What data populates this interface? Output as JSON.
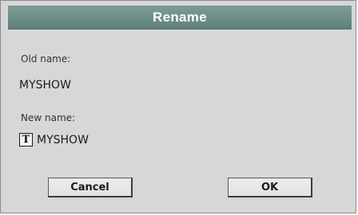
{
  "dialog": {
    "title": "Rename",
    "old_name_label": "Old name:",
    "old_name_value": "MYSHOW",
    "new_name_label": "New name:",
    "new_name_value": "MYSHOW",
    "text_edit_icon_glyph": "T",
    "text_edit_icon": "text-edit-icon"
  },
  "buttons": {
    "cancel_label": "Cancel",
    "ok_label": "OK"
  },
  "colors": {
    "title_bar": "#6f8f8a",
    "dialog_background": "#d7d7d7",
    "title_text": "#ffffff"
  }
}
